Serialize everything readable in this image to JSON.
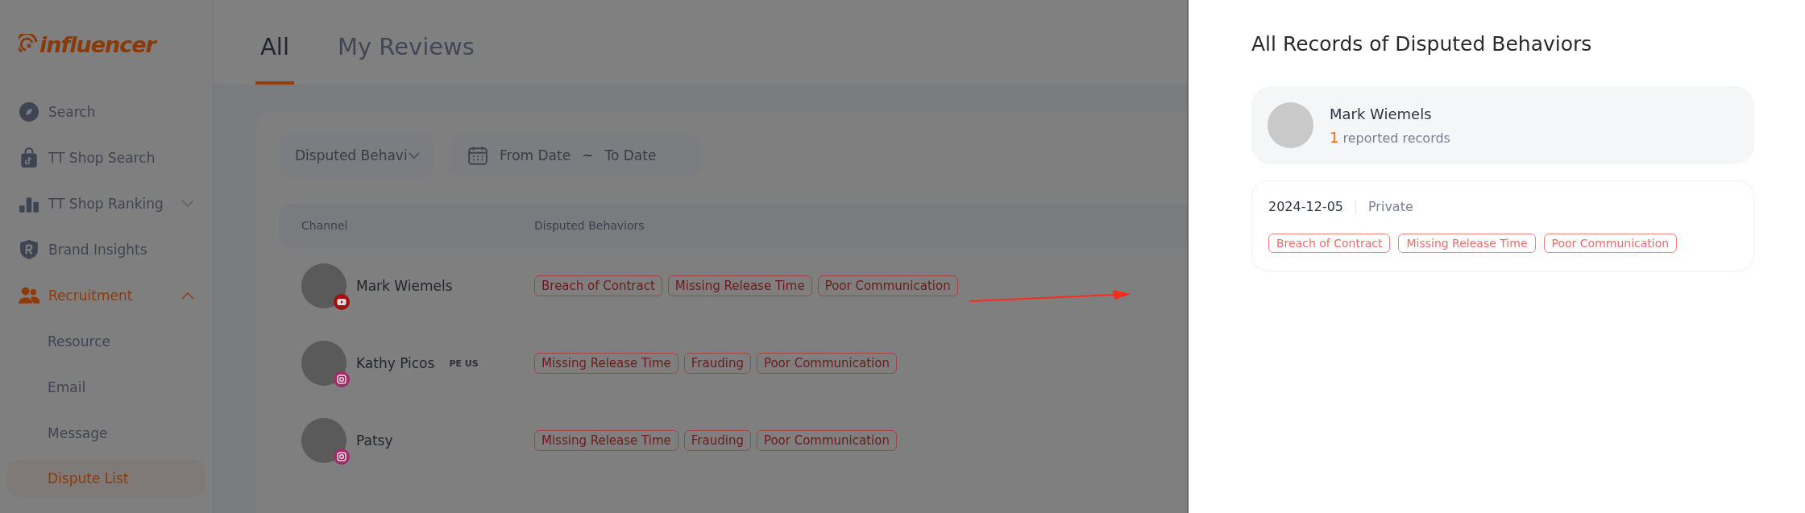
{
  "sidebar": {
    "logo": "influencer",
    "items": [
      {
        "label": "Search",
        "kind": "link",
        "selected": false
      },
      {
        "label": "TT Shop Search",
        "kind": "link",
        "selected": false
      },
      {
        "label": "TT Shop Ranking",
        "kind": "group",
        "selected": false,
        "expanded": false
      },
      {
        "label": "Brand Insights",
        "kind": "link",
        "selected": false
      },
      {
        "label": "Recruitment",
        "kind": "group",
        "selected": true,
        "expanded": true,
        "children": [
          {
            "label": "Resource",
            "selected": false
          },
          {
            "label": "Email",
            "selected": false
          },
          {
            "label": "Message",
            "selected": false
          },
          {
            "label": "Dispute List",
            "selected": true
          }
        ]
      }
    ]
  },
  "tabs": [
    {
      "label": "All",
      "selected": true
    },
    {
      "label": "My Reviews",
      "selected": false
    }
  ],
  "filters": {
    "behavior_select": {
      "placeholder": "Disputed Behavi"
    },
    "date_range": {
      "from_placeholder": "From Date",
      "separator": "~",
      "to_placeholder": "To Date"
    }
  },
  "table": {
    "columns": [
      "Channel",
      "Disputed Behaviors"
    ],
    "rows": [
      {
        "name": "Mark Wiemels",
        "kind": "video",
        "tags": [
          "Breach of Contract",
          "Missing Release Time",
          "Poor Communication"
        ]
      },
      {
        "name": "Kathy Picos",
        "regions": "PE US",
        "kind": "camera",
        "tags": [
          "Missing Release Time",
          "Frauding",
          "Poor Communication"
        ]
      },
      {
        "name": "Patsy",
        "kind": "camera",
        "tags": [
          "Missing Release Time",
          "Frauding",
          "Poor Communication"
        ]
      }
    ]
  },
  "drawer": {
    "title": "All Records of Disputed Behaviors",
    "profile": {
      "name": "Mark Wiemels",
      "count": "1",
      "count_label": "reported records"
    },
    "records": [
      {
        "date": "2024-12-05",
        "visibility": "Private",
        "tags": [
          "Breach of Contract",
          "Missing Release Time",
          "Poor Communication"
        ]
      }
    ]
  }
}
